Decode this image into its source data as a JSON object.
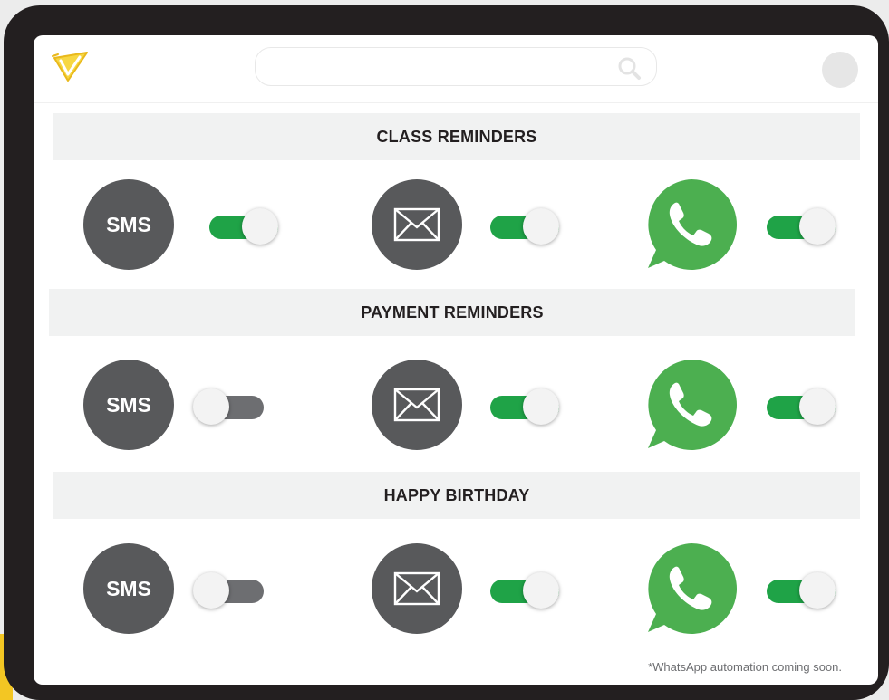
{
  "colors": {
    "frame": "#231f20",
    "toggle_on": "#1fa347",
    "toggle_off": "#6d6e71",
    "channel_bg": "#58595b",
    "whatsapp": "#4caf50",
    "logo_yellow": "#f3c623"
  },
  "header": {
    "logo_icon": "yellow-v-logo",
    "search": {
      "placeholder": "",
      "icon": "search-icon"
    },
    "avatar": "avatar-icon"
  },
  "sections": [
    {
      "title": "CLASS REMINDERS",
      "channels": {
        "sms": {
          "label": "SMS",
          "enabled": true
        },
        "email": {
          "icon": "envelope-icon",
          "enabled": true
        },
        "whatsapp": {
          "icon": "whatsapp-icon",
          "enabled": true
        }
      }
    },
    {
      "title": "PAYMENT REMINDERS",
      "channels": {
        "sms": {
          "label": "SMS",
          "enabled": false
        },
        "email": {
          "icon": "envelope-icon",
          "enabled": true
        },
        "whatsapp": {
          "icon": "whatsapp-icon",
          "enabled": true
        }
      }
    },
    {
      "title": "HAPPY BIRTHDAY",
      "channels": {
        "sms": {
          "label": "SMS",
          "enabled": false
        },
        "email": {
          "icon": "envelope-icon",
          "enabled": true
        },
        "whatsapp": {
          "icon": "whatsapp-icon",
          "enabled": true
        }
      }
    }
  ],
  "footnote": "*WhatsApp automation coming soon."
}
